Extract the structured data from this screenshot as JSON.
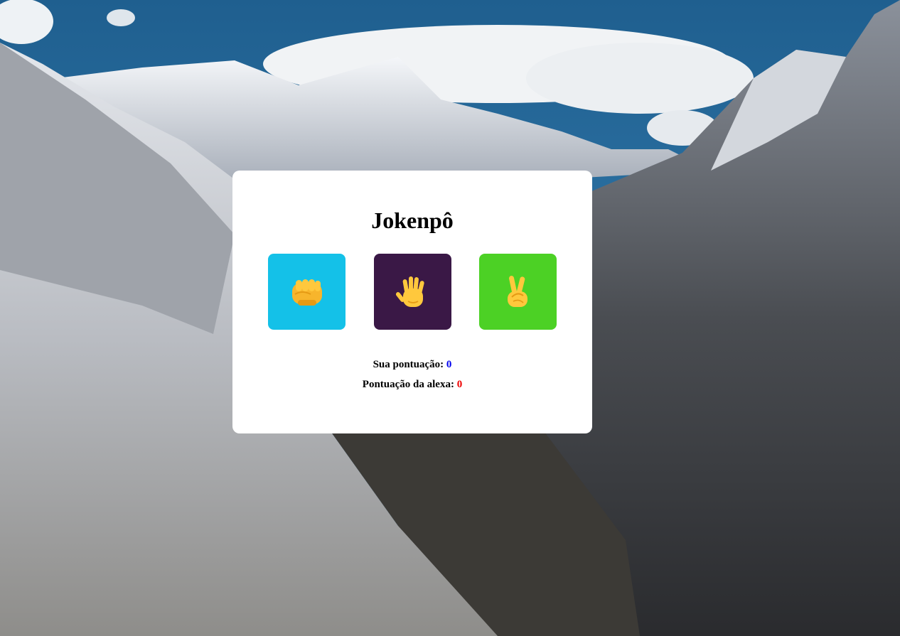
{
  "title": "Jokenpô",
  "choices": [
    {
      "label": "rock",
      "icon": "fist-icon",
      "color": "#14C1E8"
    },
    {
      "label": "paper",
      "icon": "raised-hand-icon",
      "color": "#3A1846"
    },
    {
      "label": "scissors",
      "icon": "victory-hand-icon",
      "color": "#4CD125"
    }
  ],
  "scores": {
    "player_label": "Sua pontuação:",
    "player_value": "0",
    "player_color": "#0000EE",
    "alexa_label": "Pontuação da alexa:",
    "alexa_value": "0",
    "alexa_color": "#EE0000"
  }
}
